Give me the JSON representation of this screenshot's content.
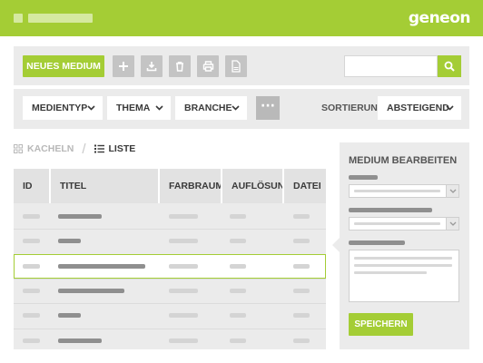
{
  "header": {
    "logo_text": "geneon",
    "brand_color": "#a4cd35"
  },
  "toolbar": {
    "new_label": "NEUES MEDIUM",
    "icons": [
      "plus-icon",
      "download-icon",
      "trash-icon",
      "print-icon",
      "csv-file-icon"
    ],
    "search": {
      "value": "",
      "placeholder": ""
    }
  },
  "filters": {
    "media_type": "MEDIENTYP",
    "theme": "THEMA",
    "industry": "BRANCHE",
    "more": "···",
    "sort_label": "SORTIERUNG",
    "sort_value": "ABSTEIGEND"
  },
  "view": {
    "tiles": "KACHELN",
    "list": "LISTE",
    "active": "list"
  },
  "table": {
    "columns": [
      "ID",
      "TITEL",
      "FARBRAUM",
      "AUFLÖSUNG",
      "DATEI"
    ],
    "row_count": 6,
    "selected_row": 3
  },
  "edit_panel": {
    "title": "MEDIUM BEARBEITEN",
    "save_label": "SPEICHERN"
  }
}
